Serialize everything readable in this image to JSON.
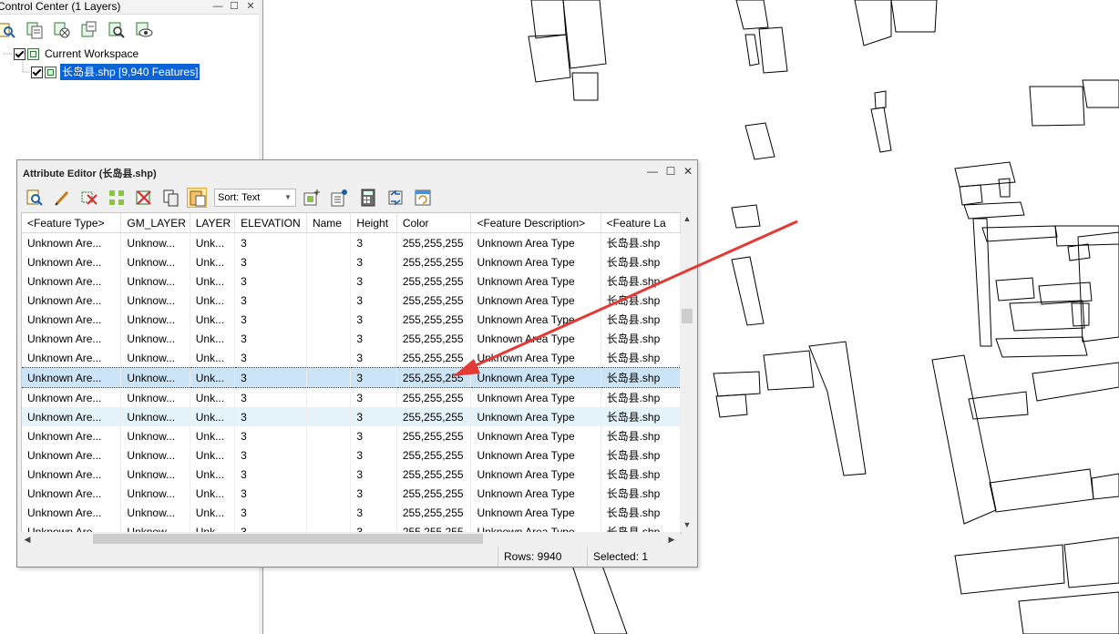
{
  "control_center": {
    "title": "Control Center (1 Layers)",
    "window_buttons": [
      "—",
      "☐",
      "✕"
    ],
    "toolbar_icons": [
      "zoom-layer-icon",
      "layer-properties-icon",
      "remove-layer-icon",
      "add-layer-icon",
      "find-icon",
      "visibility-icon"
    ],
    "tree": {
      "workspace_label": "Current Workspace",
      "layer_label": "长岛县.shp [9,940 Features]"
    }
  },
  "attribute_editor": {
    "title": "Attribute Editor (长岛县.shp)",
    "window_buttons": [
      "—",
      "☐",
      "✕"
    ],
    "toolbar_icons": [
      "search-icon",
      "edit-icon",
      "delete-feature-icon",
      "select-all-icon",
      "delete-icon",
      "copy-icon",
      "paste-icon"
    ],
    "toolbar_icons_right": [
      "add-column-icon",
      "column-properties-icon",
      "calculator-icon",
      "transform-icon",
      "refresh-icon"
    ],
    "sort": {
      "label": "Sort: Text"
    },
    "columns": [
      "<Feature Type>",
      "GM_LAYER",
      "LAYER",
      "ELEVATION",
      "Name",
      "Height",
      "Color",
      "<Feature Description>",
      "<Feature La"
    ],
    "rows": [
      [
        "Unknown Are...",
        "Unknow...",
        "Unk...",
        "3",
        "",
        "3",
        "255,255,255",
        "Unknown Area Type",
        "长岛县.shp"
      ],
      [
        "Unknown Are...",
        "Unknow...",
        "Unk...",
        "3",
        "",
        "3",
        "255,255,255",
        "Unknown Area Type",
        "长岛县.shp"
      ],
      [
        "Unknown Are...",
        "Unknow...",
        "Unk...",
        "3",
        "",
        "3",
        "255,255,255",
        "Unknown Area Type",
        "长岛县.shp"
      ],
      [
        "Unknown Are...",
        "Unknow...",
        "Unk...",
        "3",
        "",
        "3",
        "255,255,255",
        "Unknown Area Type",
        "长岛县.shp"
      ],
      [
        "Unknown Are...",
        "Unknow...",
        "Unk...",
        "3",
        "",
        "3",
        "255,255,255",
        "Unknown Area Type",
        "长岛县.shp"
      ],
      [
        "Unknown Are...",
        "Unknow...",
        "Unk...",
        "3",
        "",
        "3",
        "255,255,255",
        "Unknown Area Type",
        "长岛县.shp"
      ],
      [
        "Unknown Are...",
        "Unknow...",
        "Unk...",
        "3",
        "",
        "3",
        "255,255,255",
        "Unknown Area Type",
        "长岛县.shp"
      ],
      [
        "Unknown Are...",
        "Unknow...",
        "Unk...",
        "3",
        "",
        "3",
        "255,255,255",
        "Unknown Area Type",
        "长岛县.shp"
      ],
      [
        "Unknown Are...",
        "Unknow...",
        "Unk...",
        "3",
        "",
        "3",
        "255,255,255",
        "Unknown Area Type",
        "长岛县.shp"
      ],
      [
        "Unknown Are...",
        "Unknow...",
        "Unk...",
        "3",
        "",
        "3",
        "255,255,255",
        "Unknown Area Type",
        "长岛县.shp"
      ],
      [
        "Unknown Are...",
        "Unknow...",
        "Unk...",
        "3",
        "",
        "3",
        "255,255,255",
        "Unknown Area Type",
        "长岛县.shp"
      ],
      [
        "Unknown Are...",
        "Unknow...",
        "Unk...",
        "3",
        "",
        "3",
        "255,255,255",
        "Unknown Area Type",
        "长岛县.shp"
      ],
      [
        "Unknown Are...",
        "Unknow...",
        "Unk...",
        "3",
        "",
        "3",
        "255,255,255",
        "Unknown Area Type",
        "长岛县.shp"
      ],
      [
        "Unknown Are...",
        "Unknow...",
        "Unk...",
        "3",
        "",
        "3",
        "255,255,255",
        "Unknown Area Type",
        "长岛县.shp"
      ],
      [
        "Unknown Are...",
        "Unknow...",
        "Unk...",
        "3",
        "",
        "3",
        "255,255,255",
        "Unknown Area Type",
        "长岛县.shp"
      ],
      [
        "Unknown Are...",
        "Unknow...",
        "Unk...",
        "3",
        "",
        "3",
        "255,255,255",
        "Unknown Area Type",
        "长岛县.shp"
      ]
    ],
    "selected_row_index": 7,
    "hovered_row_index": 9,
    "status": {
      "rows": "Rows: 9940",
      "selected": "Selected: 1"
    }
  },
  "colors": {
    "selection_blue": "#0a64d8",
    "row_selected": "#cce4f7",
    "annotation_arrow": "#e53935"
  }
}
